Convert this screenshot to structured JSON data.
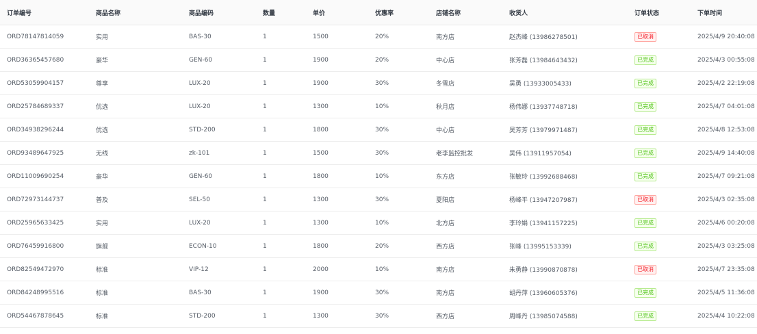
{
  "columns": [
    "订单编号",
    "商品名称",
    "商品编码",
    "数量",
    "单价",
    "优惠率",
    "店铺名称",
    "收货人",
    "订单状态",
    "下单时间"
  ],
  "rows": [
    {
      "order_id": "ORD78147814059",
      "product": "实用",
      "code": "BAS-30",
      "qty": "1",
      "price": "1500",
      "discount": "20%",
      "shop": "南方店",
      "receiver": "赵杰峰 (13986278501)",
      "status": "已取消",
      "status_type": "cancel",
      "time": "2025/4/9 20:40:08"
    },
    {
      "order_id": "ORD36365457680",
      "product": "豪华",
      "code": "GEN-60",
      "qty": "1",
      "price": "1900",
      "discount": "20%",
      "shop": "中心店",
      "receiver": "张芳磊 (13984643432)",
      "status": "已完成",
      "status_type": "done",
      "time": "2025/4/3 00:55:08"
    },
    {
      "order_id": "ORD53059904157",
      "product": "尊享",
      "code": "LUX-20",
      "qty": "1",
      "price": "1900",
      "discount": "30%",
      "shop": "冬雪店",
      "receiver": "吴勇 (13933005433)",
      "status": "已完成",
      "status_type": "done",
      "time": "2025/4/2 22:19:08"
    },
    {
      "order_id": "ORD25784689337",
      "product": "优选",
      "code": "LUX-20",
      "qty": "1",
      "price": "1300",
      "discount": "10%",
      "shop": "秋月店",
      "receiver": "杨伟娜 (13937748718)",
      "status": "已完成",
      "status_type": "done",
      "time": "2025/4/7 04:01:08"
    },
    {
      "order_id": "ORD34938296244",
      "product": "优选",
      "code": "STD-200",
      "qty": "1",
      "price": "1800",
      "discount": "30%",
      "shop": "中心店",
      "receiver": "吴芳芳 (13979971487)",
      "status": "已完成",
      "status_type": "done",
      "time": "2025/4/8 12:53:08"
    },
    {
      "order_id": "ORD93489647925",
      "product": "无线",
      "code": "zk-101",
      "qty": "1",
      "price": "1500",
      "discount": "30%",
      "shop": "老李监控批发",
      "receiver": "吴伟 (13911957054)",
      "status": "已完成",
      "status_type": "done",
      "time": "2025/4/9 14:40:08"
    },
    {
      "order_id": "ORD11009690254",
      "product": "豪华",
      "code": "GEN-60",
      "qty": "1",
      "price": "1800",
      "discount": "10%",
      "shop": "东方店",
      "receiver": "张敏玲 (13992688468)",
      "status": "已完成",
      "status_type": "done",
      "time": "2025/4/7 09:21:08"
    },
    {
      "order_id": "ORD72973144737",
      "product": "普及",
      "code": "SEL-50",
      "qty": "1",
      "price": "1300",
      "discount": "30%",
      "shop": "夏阳店",
      "receiver": "杨峰平 (13947207987)",
      "status": "已取消",
      "status_type": "cancel",
      "time": "2025/4/3 02:35:08"
    },
    {
      "order_id": "ORD25965633425",
      "product": "实用",
      "code": "LUX-20",
      "qty": "1",
      "price": "1300",
      "discount": "10%",
      "shop": "北方店",
      "receiver": "李玲娟 (13941157225)",
      "status": "已完成",
      "status_type": "done",
      "time": "2025/4/6 00:20:08"
    },
    {
      "order_id": "ORD76459916800",
      "product": "旗舰",
      "code": "ECON-10",
      "qty": "1",
      "price": "1800",
      "discount": "20%",
      "shop": "西方店",
      "receiver": "张峰 (13995153339)",
      "status": "已完成",
      "status_type": "done",
      "time": "2025/4/3 03:25:08"
    },
    {
      "order_id": "ORD82549472970",
      "product": "标准",
      "code": "VIP-12",
      "qty": "1",
      "price": "2000",
      "discount": "10%",
      "shop": "南方店",
      "receiver": "朱勇静 (13990870878)",
      "status": "已取消",
      "status_type": "cancel",
      "time": "2025/4/7 23:35:08"
    },
    {
      "order_id": "ORD84248995516",
      "product": "标准",
      "code": "BAS-30",
      "qty": "1",
      "price": "1900",
      "discount": "30%",
      "shop": "南方店",
      "receiver": "胡丹萍 (13960605376)",
      "status": "已完成",
      "status_type": "done",
      "time": "2025/4/5 11:36:08"
    },
    {
      "order_id": "ORD54467878645",
      "product": "标准",
      "code": "STD-200",
      "qty": "1",
      "price": "1300",
      "discount": "30%",
      "shop": "西方店",
      "receiver": "周峰丹 (13985074588)",
      "status": "已完成",
      "status_type": "done",
      "time": "2025/4/4 10:22:08"
    }
  ]
}
